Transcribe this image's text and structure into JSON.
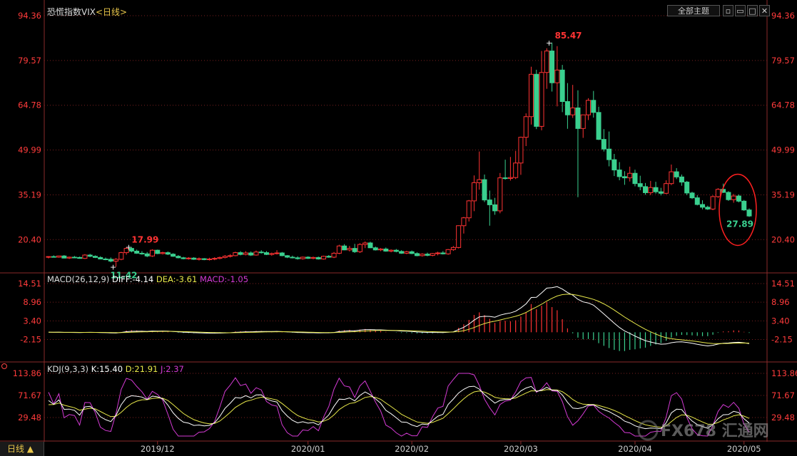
{
  "toolbar": {
    "title": "恐慌指数VIX",
    "period": "<日线>",
    "theme_button": "全部主题",
    "window_buttons": [
      "restore-icon",
      "minimize-icon",
      "maximize-icon",
      "close-icon"
    ]
  },
  "colors": {
    "up": "#ff3333",
    "down": "#3ad08f",
    "axis_text": "#ff3b3b",
    "grid": "#7a1f1f",
    "diff": "#ffffff",
    "dea": "#e8e84a",
    "macd_label": "#d33ad3",
    "k": "#ffffff",
    "d": "#e8e84a",
    "j": "#d33ad3",
    "annotation": "#ff2020"
  },
  "chart_data": [
    {
      "type": "candlestick",
      "title": "恐慌指数VIX",
      "y_ticks": [
        "94.36",
        "79.57",
        "64.78",
        "49.99",
        "35.19",
        "20.40"
      ],
      "ylim": [
        12.0,
        94.36
      ],
      "annotations": [
        {
          "text": "85.47",
          "kind": "high"
        },
        {
          "text": "17.99",
          "kind": "high"
        },
        {
          "text": "11.42",
          "kind": "low"
        },
        {
          "text": "27.89",
          "kind": "low"
        }
      ],
      "circled": "27.89",
      "candles": [
        [
          14.6,
          14.9,
          14.2,
          14.8
        ],
        [
          14.8,
          15.2,
          14.5,
          14.6
        ],
        [
          14.6,
          15.1,
          14.4,
          15.0
        ],
        [
          15.0,
          15.3,
          14.2,
          14.3
        ],
        [
          14.3,
          14.8,
          14.0,
          14.6
        ],
        [
          14.6,
          15.0,
          14.3,
          14.5
        ],
        [
          14.5,
          14.8,
          14.1,
          14.2
        ],
        [
          14.2,
          15.6,
          14.0,
          15.3
        ],
        [
          15.3,
          15.7,
          14.6,
          14.9
        ],
        [
          14.9,
          15.2,
          14.3,
          14.5
        ],
        [
          14.5,
          14.9,
          13.9,
          14.0
        ],
        [
          14.0,
          14.5,
          13.6,
          13.9
        ],
        [
          13.9,
          14.5,
          12.9,
          13.3
        ],
        [
          13.3,
          14.3,
          11.42,
          13.9
        ],
        [
          13.9,
          16.4,
          13.6,
          16.1
        ],
        [
          16.1,
          17.9,
          15.4,
          17.5
        ],
        [
          17.5,
          17.99,
          16.2,
          16.6
        ],
        [
          16.6,
          17.1,
          15.7,
          15.9
        ],
        [
          15.9,
          16.6,
          15.4,
          15.7
        ],
        [
          15.7,
          16.3,
          14.6,
          15.0
        ],
        [
          15.0,
          17.2,
          14.7,
          16.9
        ],
        [
          16.9,
          17.1,
          15.6,
          15.8
        ],
        [
          15.8,
          16.4,
          15.5,
          16.1
        ],
        [
          16.1,
          16.5,
          15.3,
          15.6
        ],
        [
          15.6,
          15.9,
          14.7,
          14.9
        ],
        [
          14.9,
          15.3,
          14.2,
          14.4
        ],
        [
          14.4,
          14.7,
          13.9,
          14.1
        ],
        [
          14.1,
          14.6,
          13.8,
          14.3
        ],
        [
          14.3,
          14.6,
          13.7,
          13.9
        ],
        [
          13.9,
          14.5,
          13.5,
          14.1
        ],
        [
          14.1,
          14.3,
          13.6,
          13.8
        ],
        [
          13.8,
          14.4,
          13.5,
          14.0
        ],
        [
          14.0,
          14.6,
          13.6,
          14.2
        ],
        [
          14.2,
          14.8,
          13.9,
          14.5
        ],
        [
          14.5,
          15.3,
          14.2,
          14.9
        ],
        [
          14.9,
          15.6,
          14.5,
          15.1
        ],
        [
          15.1,
          16.4,
          14.9,
          16.1
        ],
        [
          16.1,
          16.6,
          15.2,
          15.5
        ],
        [
          15.5,
          16.6,
          15.2,
          16.0
        ],
        [
          16.0,
          16.5,
          15.0,
          15.3
        ],
        [
          15.3,
          16.8,
          15.1,
          16.3
        ],
        [
          16.3,
          16.9,
          15.8,
          16.1
        ],
        [
          16.1,
          16.6,
          15.3,
          15.5
        ],
        [
          15.5,
          16.1,
          15.1,
          15.8
        ],
        [
          15.8,
          16.9,
          15.5,
          16.0
        ],
        [
          16.0,
          16.3,
          14.9,
          15.1
        ],
        [
          15.1,
          15.3,
          14.3,
          14.6
        ],
        [
          14.6,
          15.1,
          14.2,
          14.4
        ],
        [
          14.4,
          14.9,
          13.8,
          14.1
        ],
        [
          14.1,
          14.8,
          13.8,
          14.6
        ],
        [
          14.6,
          14.9,
          14.0,
          14.2
        ],
        [
          14.2,
          14.8,
          13.9,
          14.5
        ],
        [
          14.5,
          14.8,
          13.8,
          14.0
        ],
        [
          14.0,
          15.1,
          13.8,
          14.9
        ],
        [
          14.9,
          15.3,
          14.4,
          14.6
        ],
        [
          14.6,
          16.3,
          14.3,
          15.9
        ],
        [
          15.9,
          18.7,
          15.6,
          18.3
        ],
        [
          18.3,
          18.9,
          16.9,
          17.0
        ],
        [
          17.0,
          18.3,
          16.5,
          17.5
        ],
        [
          17.5,
          19.0,
          16.0,
          16.4
        ],
        [
          16.4,
          19.2,
          16.0,
          18.8
        ],
        [
          18.8,
          19.8,
          17.6,
          19.3
        ],
        [
          19.3,
          19.7,
          17.6,
          17.7
        ],
        [
          17.7,
          18.1,
          16.8,
          17.0
        ],
        [
          17.0,
          17.6,
          16.6,
          17.3
        ],
        [
          17.3,
          17.8,
          16.4,
          16.6
        ],
        [
          16.6,
          17.2,
          16.2,
          16.9
        ],
        [
          16.9,
          17.3,
          16.2,
          16.5
        ],
        [
          16.5,
          16.9,
          15.7,
          15.9
        ],
        [
          15.9,
          16.7,
          15.6,
          16.4
        ],
        [
          16.4,
          16.8,
          15.6,
          15.8
        ],
        [
          15.8,
          16.2,
          14.9,
          15.1
        ],
        [
          15.1,
          15.9,
          14.8,
          15.6
        ],
        [
          15.6,
          16.1,
          14.9,
          15.2
        ],
        [
          15.2,
          16.0,
          14.9,
          15.8
        ],
        [
          15.8,
          16.4,
          15.2,
          16.0
        ],
        [
          16.0,
          16.6,
          15.5,
          15.7
        ],
        [
          15.7,
          17.3,
          15.4,
          17.1
        ],
        [
          17.1,
          18.3,
          16.7,
          17.8
        ],
        [
          17.8,
          25.1,
          17.5,
          25.0
        ],
        [
          25.0,
          27.9,
          22.4,
          27.6
        ],
        [
          27.6,
          33.5,
          26.4,
          33.2
        ],
        [
          33.2,
          41.6,
          29.8,
          39.2
        ],
        [
          39.2,
          49.5,
          36.9,
          40.2
        ],
        [
          40.2,
          41.9,
          32.8,
          33.5
        ],
        [
          33.5,
          36.6,
          25.0,
          31.9
        ],
        [
          31.9,
          34.2,
          28.6,
          29.9
        ],
        [
          29.9,
          42.4,
          29.1,
          40.8
        ],
        [
          40.8,
          46.8,
          40.2,
          40.6
        ],
        [
          40.6,
          47.7,
          39.9,
          40.9
        ],
        [
          40.9,
          49.7,
          40.4,
          45.7
        ],
        [
          45.7,
          54.4,
          41.8,
          54.2
        ],
        [
          54.2,
          62.1,
          51.3,
          61.0
        ],
        [
          61.0,
          77.5,
          58.4,
          75.0
        ],
        [
          75.0,
          76.5,
          56.9,
          57.8
        ],
        [
          57.8,
          82.7,
          56.5,
          75.6
        ],
        [
          75.6,
          83.6,
          70.2,
          82.7
        ],
        [
          82.7,
          85.47,
          69.3,
          72.2
        ],
        [
          72.2,
          84.3,
          64.4,
          76.4
        ],
        [
          76.4,
          78.1,
          62.5,
          66.0
        ],
        [
          66.0,
          72.1,
          57.0,
          61.6
        ],
        [
          61.6,
          71.5,
          60.6,
          63.9
        ],
        [
          63.9,
          69.7,
          34.4,
          57.1
        ],
        [
          57.1,
          60.8,
          54.0,
          61.6
        ],
        [
          61.6,
          67.1,
          59.9,
          66.4
        ],
        [
          66.4,
          69.5,
          60.7,
          62.4
        ],
        [
          62.4,
          64.3,
          53.3,
          53.5
        ],
        [
          53.5,
          56.9,
          49.5,
          50.3
        ],
        [
          50.3,
          56.1,
          44.6,
          46.8
        ],
        [
          46.8,
          48.7,
          41.4,
          43.4
        ],
        [
          43.4,
          46.0,
          40.0,
          41.2
        ],
        [
          41.2,
          43.0,
          38.5,
          40.8
        ],
        [
          40.8,
          44.5,
          39.6,
          42.3
        ],
        [
          42.3,
          43.5,
          38.0,
          38.9
        ],
        [
          38.9,
          41.5,
          36.7,
          37.9
        ],
        [
          37.9,
          39.1,
          35.2,
          35.9
        ],
        [
          35.9,
          39.8,
          35.1,
          37.6
        ],
        [
          37.6,
          39.5,
          35.6,
          36.2
        ],
        [
          36.2,
          37.5,
          35.0,
          35.7
        ],
        [
          35.7,
          40.0,
          35.4,
          38.9
        ],
        [
          38.9,
          45.2,
          38.4,
          42.8
        ],
        [
          42.8,
          44.0,
          40.4,
          41.1
        ],
        [
          41.1,
          41.9,
          38.2,
          39.4
        ],
        [
          39.4,
          39.8,
          35.1,
          35.8
        ],
        [
          35.8,
          36.2,
          33.8,
          34.2
        ],
        [
          34.2,
          35.1,
          31.7,
          32.0
        ],
        [
          32.0,
          33.4,
          30.4,
          31.1
        ],
        [
          31.1,
          31.6,
          30.2,
          30.5
        ],
        [
          30.5,
          35.0,
          30.1,
          34.6
        ],
        [
          34.6,
          37.4,
          34.2,
          37.0
        ],
        [
          37.0,
          38.9,
          35.8,
          36.0
        ],
        [
          36.0,
          36.4,
          33.2,
          33.6
        ],
        [
          33.6,
          35.5,
          32.6,
          34.8
        ],
        [
          34.8,
          35.3,
          32.7,
          33.1
        ],
        [
          33.1,
          33.5,
          29.9,
          30.2
        ],
        [
          30.2,
          30.7,
          27.89,
          28.2
        ]
      ],
      "x_ticks": [
        {
          "label": "2019/12",
          "index": 21
        },
        {
          "label": "2020/01",
          "index": 50
        },
        {
          "label": "2020/02",
          "index": 70
        },
        {
          "label": "2020/03",
          "index": 91
        },
        {
          "label": "2020/04",
          "index": 113
        },
        {
          "label": "2020/05",
          "index": 134
        }
      ]
    },
    {
      "type": "macd",
      "params": "MACD(26,12,9)",
      "legend": [
        "DIFF:-4.14",
        "DEA:-3.61",
        "MACD:-1.05"
      ],
      "y_ticks": [
        "14.51",
        "8.96",
        "3.40",
        "-2.15"
      ],
      "ylim": [
        -8.0,
        14.51
      ],
      "macd_peak": 9.0,
      "macd_trough": -5.6
    },
    {
      "type": "kdj",
      "params": "KDJ(9,3,3)",
      "legend": [
        "K:15.40",
        "D:21.91",
        "J:2.37"
      ],
      "y_ticks": [
        "113.86",
        "71.67",
        "29.48"
      ],
      "ylim": [
        -6.0,
        113.86
      ]
    }
  ],
  "footer": {
    "period_button": "日线 ▲",
    "watermark": "FX678 汇通网"
  }
}
